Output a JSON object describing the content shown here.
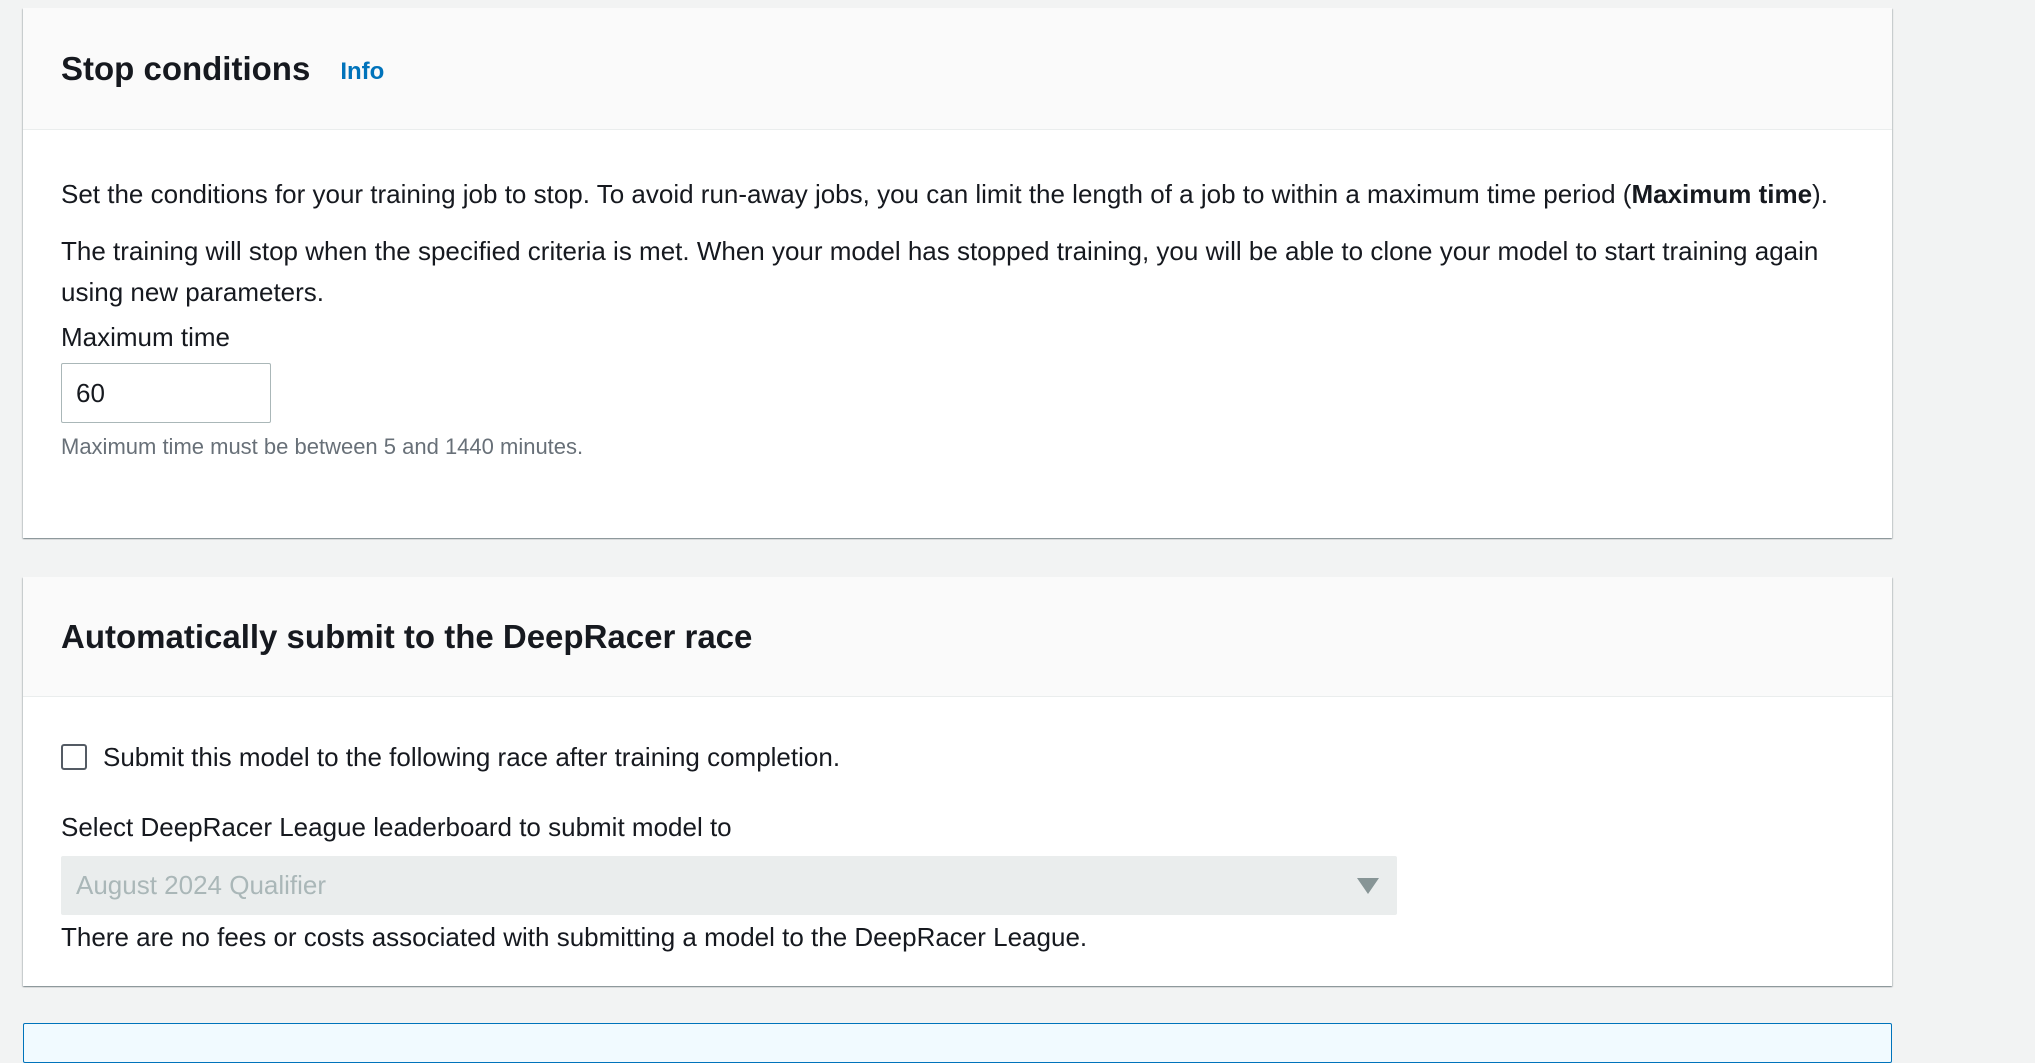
{
  "stop_conditions": {
    "title": "Stop conditions",
    "info_link": "Info",
    "para1_text": "Set the conditions for your training job to stop. To avoid run-away jobs, you can limit the length of a job to within a maximum time period (",
    "para1_bold": "Maximum time",
    "para1_end": ").",
    "para2": "The training will stop when the specified criteria is met. When your model has stopped training, you will be able to clone your model to start training again using new parameters.",
    "max_time_label": "Maximum time",
    "max_time_value": "60",
    "max_time_constraint": "Maximum time must be between 5 and 1440 minutes."
  },
  "auto_submit": {
    "title": "Automatically submit to the DeepRacer race",
    "checkbox_label": "Submit this model to the following race after training completion.",
    "checkbox_checked": false,
    "leaderboard_label": "Select DeepRacer League leaderboard to submit model to",
    "leaderboard_selected": "August 2024 Qualifier",
    "fee_note": "There are no fees or costs associated with submitting a model to the DeepRacer League."
  },
  "colors": {
    "link": "#0073bb",
    "text": "#16191f",
    "muted": "#687078",
    "disabled_bg": "#eaeded",
    "disabled_text": "#aab7b8",
    "page_bg": "#f2f3f3"
  }
}
